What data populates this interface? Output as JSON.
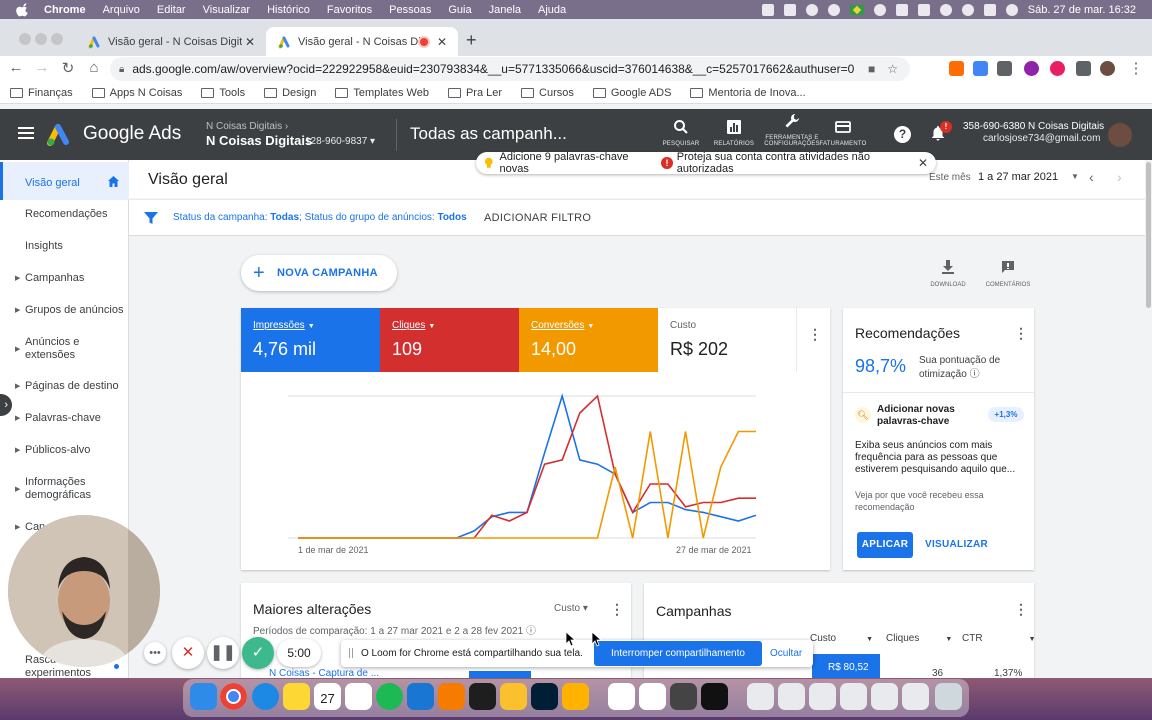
{
  "mac_menubar": {
    "app": "Chrome",
    "items": [
      "Arquivo",
      "Editar",
      "Visualizar",
      "Histórico",
      "Favoritos",
      "Pessoas",
      "Guia",
      "Janela",
      "Ajuda"
    ],
    "clock": "Sáb. 27 de mar.  16:32"
  },
  "browser": {
    "tabs": [
      {
        "title": "Visão geral - N Coisas Digitais",
        "active": false
      },
      {
        "title": "Visão geral - N Coisas Digi",
        "active": true
      }
    ],
    "url": "ads.google.com/aw/overview?ocid=222922958&euid=230793834&__u=5771335066&uscid=376014638&__c=5257017662&authuser=0",
    "bookmarks": [
      "Finanças",
      "Apps N Coisas",
      "Tools",
      "Design",
      "Templates Web",
      "Pra Ler",
      "Cursos",
      "Google ADS",
      "Mentoria de Inova..."
    ]
  },
  "ads_header": {
    "logo_text": "Google Ads",
    "account_parent": "N Coisas Digitais",
    "account_name": "N Coisas Digitais",
    "account_id": "128-960-9837",
    "title": "Todas as campanh...",
    "tools": [
      {
        "label": "PESQUISAR",
        "icon": "search-icon"
      },
      {
        "label": "RELATÓRIOS",
        "icon": "reports-icon"
      },
      {
        "label": "FERRAMENTAS E CONFIGURAÇÕES",
        "icon": "wrench-icon"
      },
      {
        "label": "FATURAMENTO",
        "icon": "billing-icon"
      }
    ],
    "notif_badge": "!",
    "user_line1": "358-690-6380 N Coisas Digitais",
    "user_line2": "carlosjose734@gmail.com"
  },
  "sidebar": {
    "items": [
      {
        "label": "Visão geral",
        "active": true
      },
      {
        "label": "Recomendações"
      },
      {
        "label": "Insights"
      },
      {
        "label": "Campanhas",
        "caret": true
      },
      {
        "label": "Grupos de anúncios",
        "caret": true
      },
      {
        "label": "Anúncios e extensões",
        "caret": true
      },
      {
        "label": "Páginas de destino",
        "caret": true
      },
      {
        "label": "Palavras-chave",
        "caret": true
      },
      {
        "label": "Públicos-alvo",
        "caret": true
      },
      {
        "label": "Informações demográficas",
        "caret": true
      },
      {
        "label": "Can",
        "caret": true
      },
      {
        "label": "Rascu experimentos"
      }
    ]
  },
  "main": {
    "title": "Visão geral",
    "date_label": "Este mês",
    "date_value": "1 a 27 mar 2021",
    "filter": {
      "k1": "Status da campanha:",
      "v1": "Todas",
      "k2": "; Status do grupo de anúncios:",
      "v2": "Todos",
      "add": "ADICIONAR FILTRO"
    },
    "notification": {
      "msg1": "Adicione 9 palavras-chave novas",
      "msg2": "Proteja sua conta contra atividades não autorizadas"
    },
    "new_campaign": "NOVA CAMPANHA",
    "download": "DOWNLOAD",
    "comments": "COMENTÁRIOS"
  },
  "overview": {
    "metrics": [
      {
        "label": "Impressões",
        "value": "4,76 mil",
        "color": "#1a73e8"
      },
      {
        "label": "Cliques",
        "value": "109",
        "color": "#d32f2f"
      },
      {
        "label": "Conversões",
        "value": "14,00",
        "color": "#f29900"
      },
      {
        "label": "Custo",
        "value": "R$ 202",
        "color": "#ffffff"
      }
    ],
    "x_start": "1 de mar de 2021",
    "x_end": "27 de mar de 2021"
  },
  "chart_data": {
    "type": "line",
    "x": [
      "1 de mar de 2021",
      "2",
      "3",
      "4",
      "5",
      "6",
      "7",
      "8",
      "9",
      "10",
      "11",
      "12",
      "13",
      "14",
      "15",
      "16",
      "17",
      "18",
      "19",
      "20",
      "21",
      "22",
      "23",
      "24",
      "25",
      "26",
      "27 de mar de 2021"
    ],
    "series": [
      {
        "name": "Impressões",
        "color": "#1a73e8",
        "values": [
          0,
          0,
          0,
          0,
          0,
          0,
          0,
          0,
          0,
          0,
          5,
          15,
          18,
          18,
          60,
          100,
          55,
          52,
          45,
          18,
          25,
          25,
          20,
          18,
          15,
          12,
          16
        ]
      },
      {
        "name": "Cliques",
        "color": "#d32f2f",
        "values": [
          0,
          0,
          0,
          0,
          0,
          0,
          0,
          0,
          0,
          0,
          0,
          16,
          12,
          18,
          52,
          55,
          88,
          100,
          45,
          18,
          38,
          38,
          22,
          25,
          25,
          28,
          28
        ]
      },
      {
        "name": "Conversões",
        "color": "#f29900",
        "values": [
          0,
          0,
          0,
          0,
          0,
          0,
          0,
          0,
          0,
          0,
          0,
          0,
          0,
          0,
          0,
          0,
          0,
          0,
          50,
          0,
          75,
          0,
          75,
          0,
          50,
          75,
          75
        ]
      }
    ]
  },
  "recommendations": {
    "title": "Recomendações",
    "score": "98,7%",
    "score_label": "Sua pontuação de otimização",
    "item_title": "Adicionar novas palavras-chave",
    "item_badge": "+1,3%",
    "item_desc": "Exiba seus anúncios com mais frequência para as pessoas que estiverem pesquisando aquilo que...",
    "why": "Veja por que você recebeu essa recomendação",
    "apply": "APLICAR",
    "view": "VISUALIZAR"
  },
  "changes_card": {
    "title": "Maiores alterações",
    "sort": "Custo",
    "period": "Períodos de comparação: 1 a 27 mar 2021 e 2 a 28 fev 2021",
    "row": "N Coisas - Captura de ..."
  },
  "campaigns_card": {
    "title": "Campanhas",
    "columns": [
      "Custo",
      "Cliques",
      "CTR"
    ],
    "row": {
      "cost": "R$ 80,52",
      "clicks": "36",
      "ctr": "1,37%"
    }
  },
  "loom": {
    "message": "O Loom for Chrome está compartilhando sua tela.",
    "stop": "Interromper compartilhamento",
    "hide": "Ocultar",
    "timer": "5:00"
  },
  "dock": {
    "calendar_day": "27"
  }
}
